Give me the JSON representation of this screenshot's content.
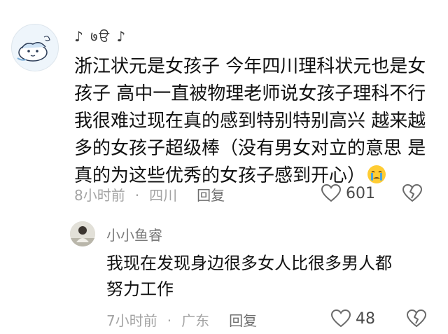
{
  "comments": [
    {
      "username": "♪ ७ੳ ♪",
      "text": "浙江状元是女孩子 今年四川理科状元也是女\n孩子 高中一直被物理老师说女孩子理科不行\n我很难过现在真的感到特别特别高兴 越来越\n多的女孩子超级棒（没有男女对立的意思 是\n真的为这些优秀的女孩子感到开心）",
      "emoji": "crying-face-emoji",
      "time": "8小时前",
      "separator": "·",
      "location": "四川",
      "reply_label": "回复",
      "likes": "601",
      "avatar_icon": "cartoon-avatar-icon"
    },
    {
      "username": "小小鱼睿",
      "text": "我现在发现身边很多女人比很多男人都\n努力工作",
      "time": "7小时前",
      "separator": "·",
      "location": "广东",
      "reply_label": "回复",
      "likes": "48",
      "avatar_icon": "photo-avatar-icon"
    }
  ],
  "icons": {
    "like": "heart-icon",
    "dislike": "broken-heart-icon"
  },
  "colors": {
    "text": "#111111",
    "meta": "#a3a3a3",
    "reply": "#6e6e6e",
    "emoji_yellow": "#ffcc33",
    "tear_blue": "#4aa3df"
  }
}
